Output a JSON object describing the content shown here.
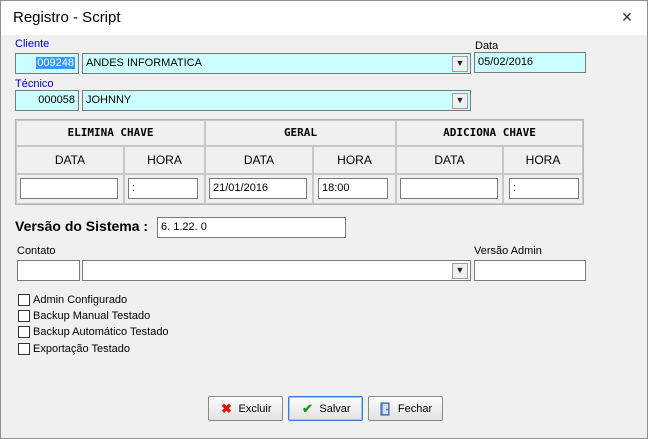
{
  "window": {
    "title": "Registro - Script",
    "close_glyph": "✕"
  },
  "cliente": {
    "label": "Cliente",
    "code": "009248",
    "name": "ANDES INFORMATICA"
  },
  "data": {
    "label": "Data",
    "value": "05/02/2016"
  },
  "tecnico": {
    "label": "Técnico",
    "code": "000058",
    "name": "JOHNNY"
  },
  "schedule": {
    "sub_data": "DATA",
    "sub_hora": "HORA",
    "groups": [
      {
        "title": "ELIMINA CHAVE",
        "date": "",
        "time": ":"
      },
      {
        "title": "GERAL",
        "date": "21/01/2016",
        "time": "18:00"
      },
      {
        "title": "ADICIONA CHAVE",
        "date": "",
        "time": ":"
      }
    ]
  },
  "versao_sistema": {
    "label": "Versão do Sistema :",
    "value": "6. 1.22. 0"
  },
  "contato": {
    "label": "Contato",
    "code": "",
    "name": ""
  },
  "versao_admin": {
    "label": "Versão Admin",
    "value": ""
  },
  "checkboxes": [
    {
      "label": "Admin Configurado",
      "checked": false
    },
    {
      "label": "Backup Manual Testado",
      "checked": false
    },
    {
      "label": "Backup Automático Testado",
      "checked": false
    },
    {
      "label": "Exportação Testado",
      "checked": false
    }
  ],
  "buttons": {
    "excluir": "Excluir",
    "salvar": "Salvar",
    "fechar": "Fechar"
  },
  "icons": {
    "dropdown": "chevron-down-icon",
    "excluir": "red-x-icon",
    "salvar": "green-check-icon",
    "fechar": "door-exit-icon"
  },
  "colors": {
    "label_blue": "#0000cc",
    "field_cyan": "#ccffff",
    "selection": "#3399ff"
  }
}
